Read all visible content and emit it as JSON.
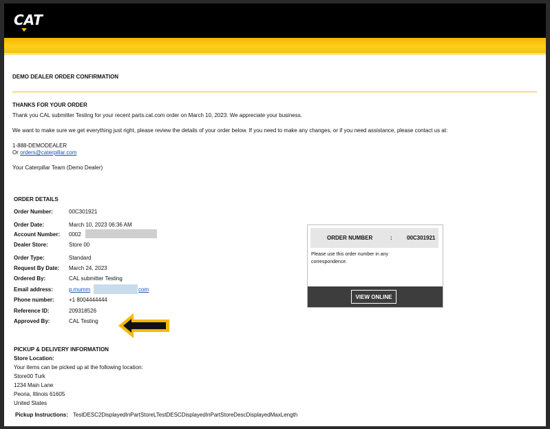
{
  "header": {
    "logo_text": "CAT"
  },
  "page_title": "DEMO DEALER ORDER CONFIRMATION",
  "thanks": {
    "heading": "THANKS FOR YOUR ORDER",
    "line1": "Thank you CAL submitter Testing for your recent parts.cat.com order on March 10, 2023. We appreciate your business.",
    "line2": "We want to make sure we get everything just right, please review the details of your order below. If you need to make any changes, or if you need assistance, please contact us at:",
    "phone": "1-888-DEMODEALER",
    "or_prefix": "Or ",
    "email": "orders@caterpillar.com",
    "signoff": "Your Caterpillar Team (Demo Dealer)"
  },
  "order_details": {
    "heading": "ORDER DETAILS",
    "rows": [
      {
        "label": "Order Number:",
        "value": "00C301921"
      },
      {
        "label": "Order Date:",
        "value": "March 10, 2023  06:36 AM"
      },
      {
        "label": "Account Number:",
        "value": "0002"
      },
      {
        "label": "Dealer Store:",
        "value": "Store 00"
      },
      {
        "label": "Order Type:",
        "value": "Standard"
      },
      {
        "label": "Request By Date:",
        "value": "March 24, 2023"
      },
      {
        "label": "Ordered By:",
        "value": "CAL submitter Testing"
      },
      {
        "label": "Email address:",
        "value_start": "p.mumm",
        "value_end": "com"
      },
      {
        "label": "Phone number:",
        "value": "+1 8004444444"
      },
      {
        "label": "Reference ID:",
        "value": "209318526"
      },
      {
        "label": "Approved By:",
        "value": "CAL Testing"
      }
    ]
  },
  "order_box": {
    "label": "ORDER NUMBER",
    "separator": ":",
    "number": "00C301921",
    "note": "Please use this order number in any correspondence.",
    "button": "VIEW ONLINE"
  },
  "pickup": {
    "heading": "PICKUP & DELIVERY INFORMATION",
    "store_location_label": "Store Location:",
    "intro": "Your items can be picked up at the following location:",
    "address": [
      "Store00 Turk",
      "1234 Main Lane",
      "Peoria, Illinois 61605",
      "United States"
    ],
    "instructions_label": "Pickup Instructions:",
    "instructions": "TestDESC2DisplayedInPartStoreLTestDESCDisplayedInPartStoreDescDisplayedMaxLength"
  },
  "colors": {
    "brand_yellow": "#F5C400",
    "arrow_yellow": "#F5B800",
    "header_black": "#000000"
  }
}
